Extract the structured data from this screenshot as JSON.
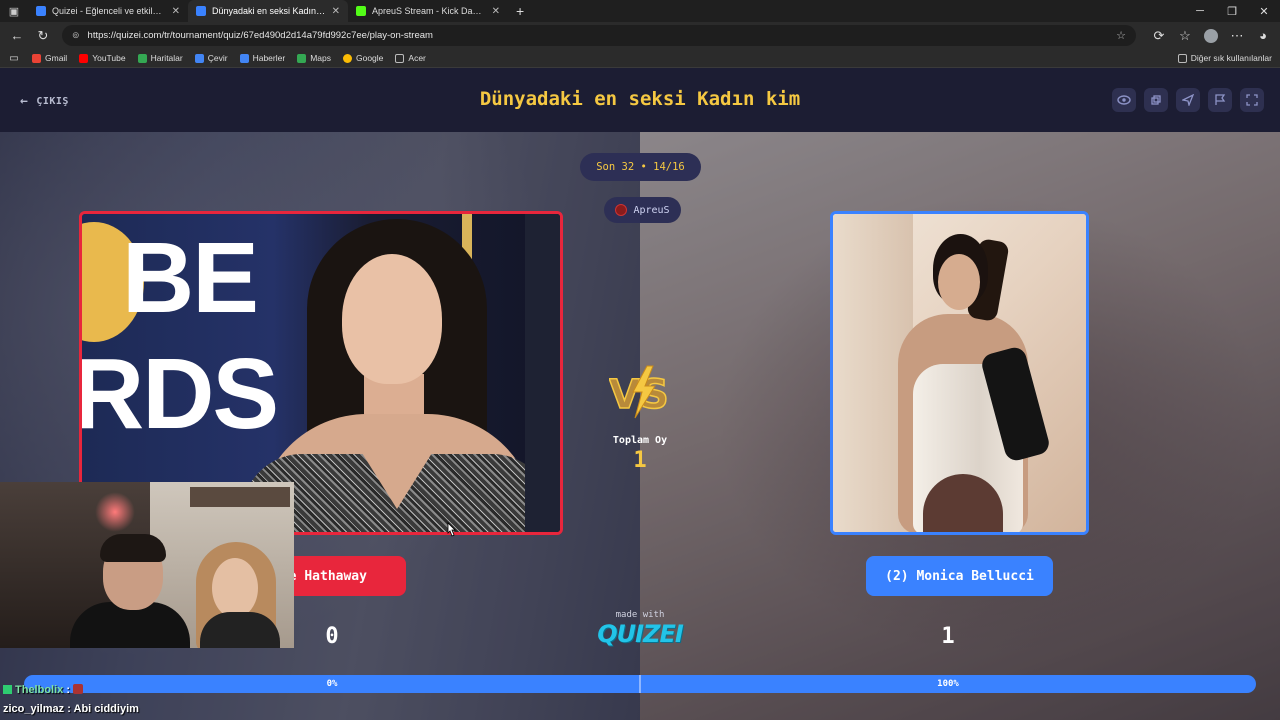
{
  "browser": {
    "tabs": [
      {
        "title": "Quizei - Eğlenceli ve etkileşimli q",
        "favicon_color": "#3a82ff",
        "active": false
      },
      {
        "title": "Dünyadaki en seksi Kadın kim - T",
        "favicon_color": "#3a82ff",
        "active": true
      },
      {
        "title": "ApreuS Stream - Kick Dashboard",
        "favicon_color": "#53fc18",
        "active": false
      }
    ],
    "url": "https://quizei.com/tr/tournament/quiz/67ed490d2d14a79fd992c7ee/play-on-stream",
    "bookmarks": [
      {
        "label": "Gmail",
        "color": "#ea4335"
      },
      {
        "label": "YouTube",
        "color": "#ff0000"
      },
      {
        "label": "Haritalar",
        "color": "#34a853"
      },
      {
        "label": "Çevir",
        "color": "#4285f4"
      },
      {
        "label": "Haberler",
        "color": "#4285f4"
      },
      {
        "label": "Maps",
        "color": "#34a853"
      },
      {
        "label": "Google",
        "color": "#fbbc05"
      },
      {
        "label": "Acer",
        "color": "#9aa0a6"
      }
    ],
    "bookmarks_right": "Diğer sık kullanılanlar"
  },
  "quiz": {
    "exit_label": "ÇIKIŞ",
    "title": "Dünyadaki en seksi Kadın kim",
    "round": "Son 32 • 14/16",
    "streamer": "ApreuS",
    "total_votes_label": "Toplam Oy",
    "total_votes": "1",
    "made_with": "made with",
    "logo": "QUIZEI",
    "left": {
      "name": "nne Hathaway",
      "score": "0",
      "percent": "0%",
      "color": "#e8263c"
    },
    "right": {
      "name": "(2) Monica Bellucci",
      "score": "1",
      "percent": "100%",
      "color": "#3a82ff"
    },
    "tool_icons": [
      "eye-icon",
      "share-icon",
      "send-icon",
      "flag-icon",
      "fullscreen-icon"
    ]
  },
  "chat": [
    {
      "user": "Thelbolix",
      "sep": " : ",
      "text": ""
    },
    {
      "user": "zico_yilmaz",
      "sep": " : ",
      "text": "Abi ciddiyim"
    }
  ]
}
